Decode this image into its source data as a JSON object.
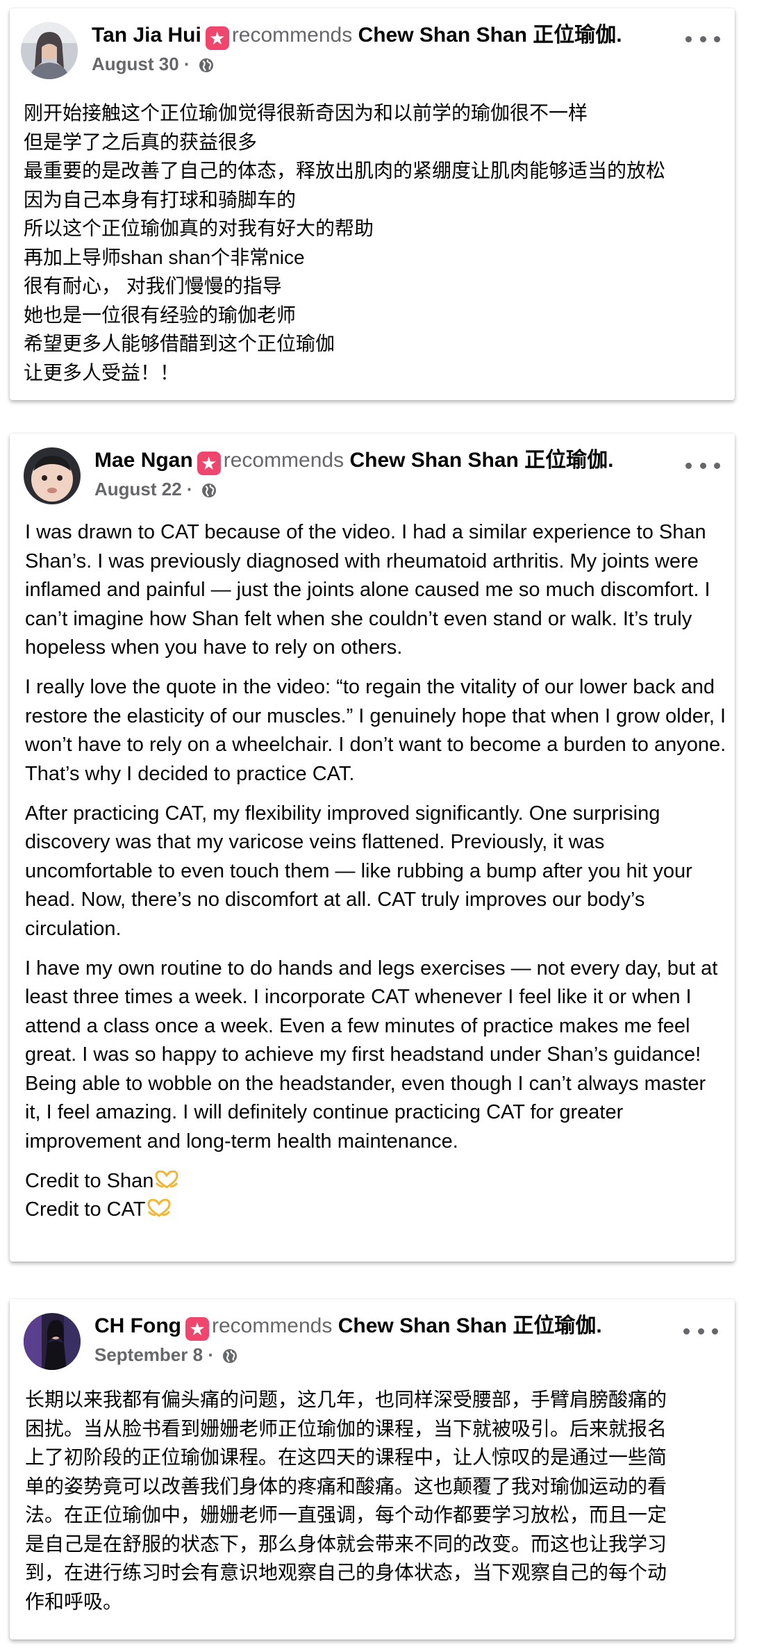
{
  "posts": [
    {
      "author": "Tan Jia Hui",
      "recommends": "recommends",
      "page": "Chew Shan Shan 正位瑜伽.",
      "date": "August 30",
      "date_sep": "·",
      "avatar_icon": "user-photo",
      "body_lines": [
        "刚开始接触这个正位瑜伽觉得很新奇因为和以前学的瑜伽很不一样",
        "但是学了之后真的获益很多",
        "最重要的是改善了自己的体态，释放出肌肉的紧绷度让肌肉能够适当的放松",
        "因为自己本身有打球和骑脚车的",
        "所以这个正位瑜伽真的对我有好大的帮助",
        "再加上导师shan shan个非常nice",
        "很有耐心， 对我们慢慢的指导",
        "她也是一位很有经验的瑜伽老师",
        "希望更多人能够借醋到这个正位瑜伽",
        "让更多人受益！！"
      ]
    },
    {
      "author": "Mae Ngan",
      "recommends": "recommends",
      "page": "Chew Shan Shan 正位瑜伽.",
      "date": "August 22",
      "date_sep": "·",
      "avatar_icon": "user-photo",
      "paragraphs": [
        "I was drawn to CAT because of the video. I had a similar experience to Shan Shan’s. I was previously diagnosed with rheumatoid arthritis. My joints were inflamed and painful — just the joints alone caused me so much discomfort. I can’t imagine how Shan felt when she couldn’t even stand or walk. It’s truly hopeless when you have to rely on others.",
        "I really love the quote in the video: “to regain the vitality of our lower back and restore the elasticity of our muscles.” I genuinely hope that when I grow older, I won’t have to rely on a wheelchair. I don’t want to become a burden to anyone. That’s why I decided to practice CAT.",
        "After practicing CAT, my flexibility improved significantly. One surprising discovery was that my varicose veins flattened. Previously, it was uncomfortable to even touch them — like rubbing a bump after you hit your head. Now, there’s no discomfort at all. CAT truly improves our body’s circulation.",
        "I have my own routine to do hands and legs exercises — not every day, but at least three times a week. I incorporate CAT whenever I feel like it or when I attend a class once a week. Even a few minutes of practice makes me feel great. I was so happy to achieve my first headstand under Shan’s guidance! Being able to wobble on the headstander, even though I can’t always master it, I feel amazing. I will definitely continue practicing CAT for greater improvement and long-term health maintenance."
      ],
      "credits": [
        "Credit to Shan",
        "Credit to CAT"
      ],
      "credit_icon": "heart-hands-icon"
    },
    {
      "author": "CH Fong",
      "recommends": "recommends",
      "page": "Chew Shan Shan 正位瑜伽.",
      "date": "September 8",
      "date_sep": "·",
      "avatar_icon": "user-photo",
      "body_lines": [
        "长期以来我都有偏头痛的问题，这几年，也同样深受腰部，手臂肩膀酸痛的",
        "困扰。当从脸书看到姗姗老师正位瑜伽的课程，当下就被吸引。后来就报名",
        "上了初阶段的正位瑜伽课程。在这四天的课程中，让人惊叹的是通过一些简",
        "单的姿势竟可以改善我们身体的疼痛和酸痛。这也颠覆了我对瑜伽运动的看",
        "法。在正位瑜伽中，姗姗老师一直强调，每个动作都要学习放松，而且一定",
        "是自己是在舒服的状态下，那么身体就会带来不同的改变。而这也让我学习",
        "到，在进行练习时会有意识地观察自己的身体状态，当下观察自己的每个动",
        "作和呼吸。"
      ]
    }
  ],
  "colors": {
    "badge": "#f0466e",
    "secondary_text": "#65676b",
    "primary_text": "#050505"
  }
}
